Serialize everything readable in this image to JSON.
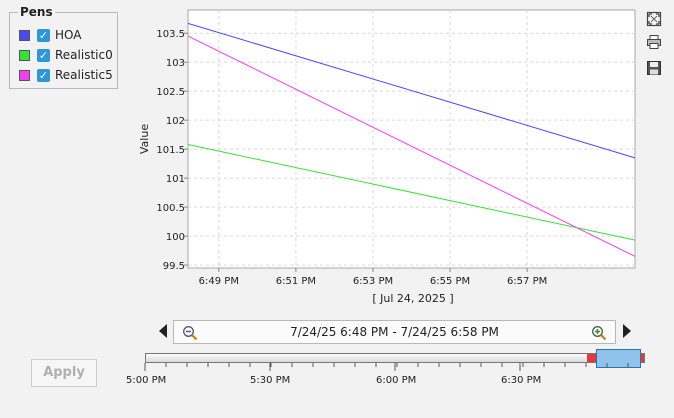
{
  "pens": {
    "title": "Pens",
    "items": [
      {
        "label": "HOA",
        "color": "#4a4af0",
        "checked": true
      },
      {
        "label": "Realistic0",
        "color": "#38e038",
        "checked": true
      },
      {
        "label": "Realistic5",
        "color": "#f040f0",
        "checked": true
      }
    ]
  },
  "chart_data": {
    "type": "line",
    "ylabel": "Value",
    "xlabel": "[ Jul 24, 2025 ]",
    "ylim": [
      99.45,
      103.9
    ],
    "y_ticks": [
      "99.5",
      "100",
      "100.5",
      "101",
      "101.5",
      "102",
      "102.5",
      "103",
      "103.5"
    ],
    "x_ticks": [
      "6:49 PM",
      "6:51 PM",
      "6:53 PM",
      "6:55 PM",
      "6:57 PM"
    ],
    "x_tick_minutes": [
      49,
      51,
      53,
      55,
      57
    ],
    "xlim_minutes": [
      48.2,
      59.8
    ],
    "series": [
      {
        "name": "HOA",
        "color": "#4a4af0",
        "x": [
          48.2,
          59.8
        ],
        "y": [
          103.67,
          101.35
        ]
      },
      {
        "name": "Realistic0",
        "color": "#38e038",
        "x": [
          48.2,
          59.8
        ],
        "y": [
          101.58,
          99.93
        ]
      },
      {
        "name": "Realistic5",
        "color": "#f040f0",
        "x": [
          48.2,
          59.8
        ],
        "y": [
          103.45,
          99.65
        ]
      }
    ],
    "grid": true
  },
  "toolbar": {
    "icons": [
      "fit-icon",
      "print-icon",
      "save-icon"
    ]
  },
  "range": {
    "text": "7/24/25 6:48 PM - 7/24/25 6:58 PM"
  },
  "apply_label": "Apply",
  "timeline": {
    "labels": [
      "5:00 PM",
      "5:30 PM",
      "6:00 PM",
      "6:30 PM"
    ]
  }
}
